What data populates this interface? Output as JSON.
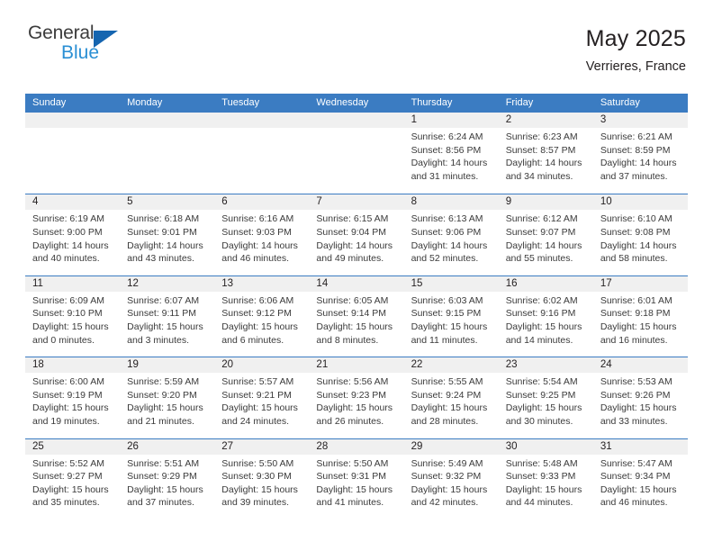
{
  "brand": {
    "name_top": "General",
    "name_bottom": "Blue",
    "logo_icon": "blue-triangle-icon"
  },
  "header": {
    "title": "May 2025",
    "subtitle": "Verrieres, France"
  },
  "colors": {
    "header_blue": "#3b7cc2",
    "row_separator": "#3b7cc2",
    "daynum_band": "#f0f0f0",
    "brand_blue": "#2a8fd4",
    "triangle_blue": "#1565b0",
    "text": "#231f20"
  },
  "calendar": {
    "day_headers": [
      "Sunday",
      "Monday",
      "Tuesday",
      "Wednesday",
      "Thursday",
      "Friday",
      "Saturday"
    ],
    "weeks": [
      [
        {
          "day": "",
          "lines": []
        },
        {
          "day": "",
          "lines": []
        },
        {
          "day": "",
          "lines": []
        },
        {
          "day": "",
          "lines": []
        },
        {
          "day": "1",
          "lines": [
            "Sunrise: 6:24 AM",
            "Sunset: 8:56 PM",
            "Daylight: 14 hours",
            "and 31 minutes."
          ]
        },
        {
          "day": "2",
          "lines": [
            "Sunrise: 6:23 AM",
            "Sunset: 8:57 PM",
            "Daylight: 14 hours",
            "and 34 minutes."
          ]
        },
        {
          "day": "3",
          "lines": [
            "Sunrise: 6:21 AM",
            "Sunset: 8:59 PM",
            "Daylight: 14 hours",
            "and 37 minutes."
          ]
        }
      ],
      [
        {
          "day": "4",
          "lines": [
            "Sunrise: 6:19 AM",
            "Sunset: 9:00 PM",
            "Daylight: 14 hours",
            "and 40 minutes."
          ]
        },
        {
          "day": "5",
          "lines": [
            "Sunrise: 6:18 AM",
            "Sunset: 9:01 PM",
            "Daylight: 14 hours",
            "and 43 minutes."
          ]
        },
        {
          "day": "6",
          "lines": [
            "Sunrise: 6:16 AM",
            "Sunset: 9:03 PM",
            "Daylight: 14 hours",
            "and 46 minutes."
          ]
        },
        {
          "day": "7",
          "lines": [
            "Sunrise: 6:15 AM",
            "Sunset: 9:04 PM",
            "Daylight: 14 hours",
            "and 49 minutes."
          ]
        },
        {
          "day": "8",
          "lines": [
            "Sunrise: 6:13 AM",
            "Sunset: 9:06 PM",
            "Daylight: 14 hours",
            "and 52 minutes."
          ]
        },
        {
          "day": "9",
          "lines": [
            "Sunrise: 6:12 AM",
            "Sunset: 9:07 PM",
            "Daylight: 14 hours",
            "and 55 minutes."
          ]
        },
        {
          "day": "10",
          "lines": [
            "Sunrise: 6:10 AM",
            "Sunset: 9:08 PM",
            "Daylight: 14 hours",
            "and 58 minutes."
          ]
        }
      ],
      [
        {
          "day": "11",
          "lines": [
            "Sunrise: 6:09 AM",
            "Sunset: 9:10 PM",
            "Daylight: 15 hours",
            "and 0 minutes."
          ]
        },
        {
          "day": "12",
          "lines": [
            "Sunrise: 6:07 AM",
            "Sunset: 9:11 PM",
            "Daylight: 15 hours",
            "and 3 minutes."
          ]
        },
        {
          "day": "13",
          "lines": [
            "Sunrise: 6:06 AM",
            "Sunset: 9:12 PM",
            "Daylight: 15 hours",
            "and 6 minutes."
          ]
        },
        {
          "day": "14",
          "lines": [
            "Sunrise: 6:05 AM",
            "Sunset: 9:14 PM",
            "Daylight: 15 hours",
            "and 8 minutes."
          ]
        },
        {
          "day": "15",
          "lines": [
            "Sunrise: 6:03 AM",
            "Sunset: 9:15 PM",
            "Daylight: 15 hours",
            "and 11 minutes."
          ]
        },
        {
          "day": "16",
          "lines": [
            "Sunrise: 6:02 AM",
            "Sunset: 9:16 PM",
            "Daylight: 15 hours",
            "and 14 minutes."
          ]
        },
        {
          "day": "17",
          "lines": [
            "Sunrise: 6:01 AM",
            "Sunset: 9:18 PM",
            "Daylight: 15 hours",
            "and 16 minutes."
          ]
        }
      ],
      [
        {
          "day": "18",
          "lines": [
            "Sunrise: 6:00 AM",
            "Sunset: 9:19 PM",
            "Daylight: 15 hours",
            "and 19 minutes."
          ]
        },
        {
          "day": "19",
          "lines": [
            "Sunrise: 5:59 AM",
            "Sunset: 9:20 PM",
            "Daylight: 15 hours",
            "and 21 minutes."
          ]
        },
        {
          "day": "20",
          "lines": [
            "Sunrise: 5:57 AM",
            "Sunset: 9:21 PM",
            "Daylight: 15 hours",
            "and 24 minutes."
          ]
        },
        {
          "day": "21",
          "lines": [
            "Sunrise: 5:56 AM",
            "Sunset: 9:23 PM",
            "Daylight: 15 hours",
            "and 26 minutes."
          ]
        },
        {
          "day": "22",
          "lines": [
            "Sunrise: 5:55 AM",
            "Sunset: 9:24 PM",
            "Daylight: 15 hours",
            "and 28 minutes."
          ]
        },
        {
          "day": "23",
          "lines": [
            "Sunrise: 5:54 AM",
            "Sunset: 9:25 PM",
            "Daylight: 15 hours",
            "and 30 minutes."
          ]
        },
        {
          "day": "24",
          "lines": [
            "Sunrise: 5:53 AM",
            "Sunset: 9:26 PM",
            "Daylight: 15 hours",
            "and 33 minutes."
          ]
        }
      ],
      [
        {
          "day": "25",
          "lines": [
            "Sunrise: 5:52 AM",
            "Sunset: 9:27 PM",
            "Daylight: 15 hours",
            "and 35 minutes."
          ]
        },
        {
          "day": "26",
          "lines": [
            "Sunrise: 5:51 AM",
            "Sunset: 9:29 PM",
            "Daylight: 15 hours",
            "and 37 minutes."
          ]
        },
        {
          "day": "27",
          "lines": [
            "Sunrise: 5:50 AM",
            "Sunset: 9:30 PM",
            "Daylight: 15 hours",
            "and 39 minutes."
          ]
        },
        {
          "day": "28",
          "lines": [
            "Sunrise: 5:50 AM",
            "Sunset: 9:31 PM",
            "Daylight: 15 hours",
            "and 41 minutes."
          ]
        },
        {
          "day": "29",
          "lines": [
            "Sunrise: 5:49 AM",
            "Sunset: 9:32 PM",
            "Daylight: 15 hours",
            "and 42 minutes."
          ]
        },
        {
          "day": "30",
          "lines": [
            "Sunrise: 5:48 AM",
            "Sunset: 9:33 PM",
            "Daylight: 15 hours",
            "and 44 minutes."
          ]
        },
        {
          "day": "31",
          "lines": [
            "Sunrise: 5:47 AM",
            "Sunset: 9:34 PM",
            "Daylight: 15 hours",
            "and 46 minutes."
          ]
        }
      ]
    ]
  }
}
